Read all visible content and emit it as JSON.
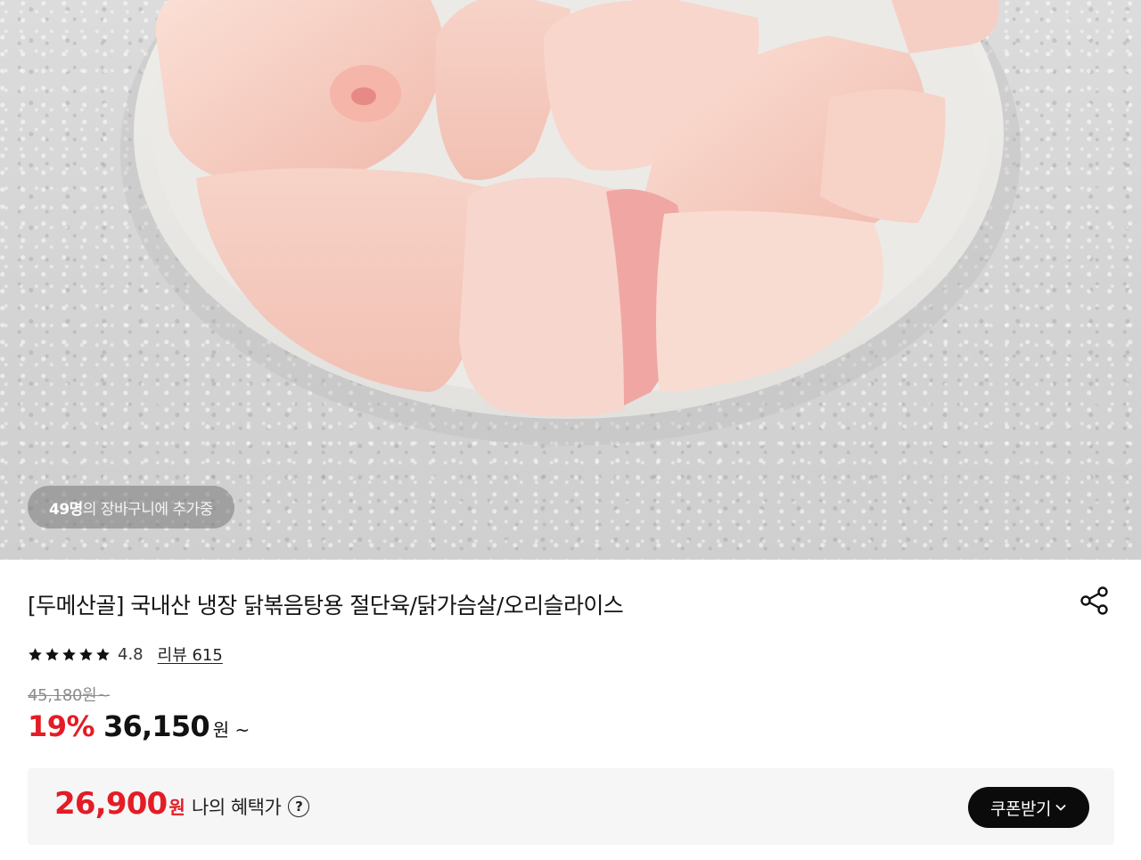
{
  "hero": {
    "image_subject": "raw chicken pieces on a white plate",
    "cart_badge": {
      "count": "49명",
      "suffix": "의 장바구니에 추가중"
    }
  },
  "product": {
    "title": "[두메산골] 국내산 냉장 닭볶음탕용 절단육/닭가슴살/오리슬라이스",
    "share_icon": "share-icon",
    "rating": {
      "stars": 5,
      "value": "4.8",
      "review_label": "리뷰 615"
    },
    "original_price": "45,180원~",
    "discount_percent": "19%",
    "sale_price": "36,150",
    "sale_unit": "원 ~"
  },
  "benefit": {
    "price": "26,900",
    "unit": "원",
    "label": "나의 혜택가",
    "help_icon": "?",
    "coupon_button": "쿠폰받기"
  },
  "colors": {
    "accent_red": "#e31c25",
    "button_black": "#0b0b0b",
    "box_bg": "#f6f6f6"
  }
}
